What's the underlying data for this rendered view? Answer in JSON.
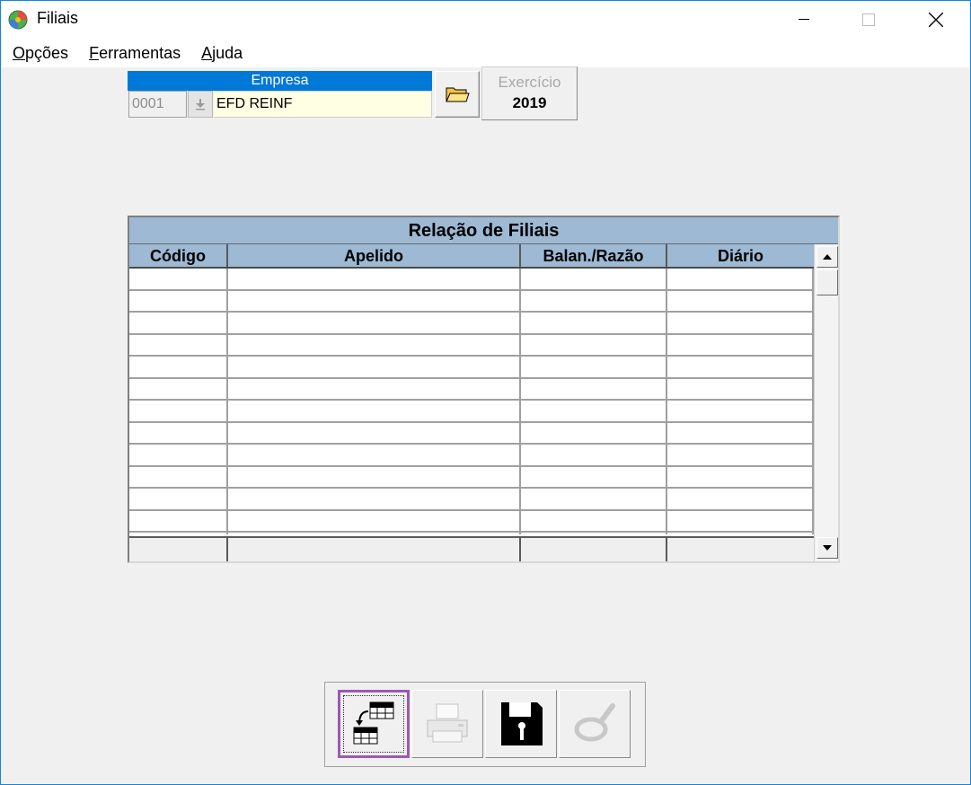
{
  "window": {
    "title": "Filiais"
  },
  "menu": {
    "items": [
      {
        "u": "O",
        "rest": "pções"
      },
      {
        "u": "F",
        "rest": "erramentas"
      },
      {
        "u": "A",
        "rest": "juda"
      }
    ]
  },
  "empresa": {
    "header": "Empresa",
    "code": "0001",
    "name": "EFD REINF"
  },
  "exercicio": {
    "label": "Exercício",
    "year": "2019"
  },
  "grid": {
    "title": "Relação de Filiais",
    "columns": [
      "Código",
      "Apelido",
      "Balan./Razão",
      "Diário"
    ]
  },
  "icons": {
    "app": "app-globe-icon",
    "open": "folder-open-icon",
    "tools": [
      "table-transfer-icon",
      "printer-icon",
      "floppy-disk-icon",
      "magnifier-icon"
    ]
  },
  "colors": {
    "accent": "#0078d7",
    "grid_header": "#9db9d4",
    "input_bg": "#ffffe4",
    "focus": "#9b59b6"
  }
}
